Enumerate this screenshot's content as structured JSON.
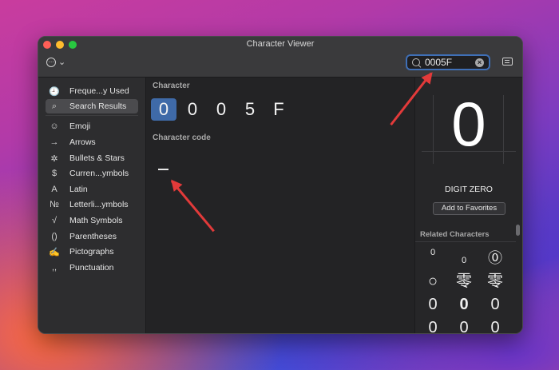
{
  "window": {
    "title": "Character Viewer",
    "traffic_lights": [
      "#ff5f57",
      "#febc2e",
      "#28c840"
    ]
  },
  "toolbar": {
    "more_icon": "ellipsis-circle-icon",
    "more_chevron": "⌄",
    "search_value": "0005F",
    "clear_symbol": "×"
  },
  "sidebar": {
    "items": [
      {
        "icon": "🕘",
        "label": "Freque...y Used",
        "selected": false
      },
      {
        "icon": "⌕",
        "label": "Search Results",
        "selected": true
      },
      {
        "icon": "☺",
        "label": "Emoji",
        "selected": false
      },
      {
        "icon": "→",
        "label": "Arrows",
        "selected": false
      },
      {
        "icon": "✲",
        "label": "Bullets & Stars",
        "selected": false
      },
      {
        "icon": "$",
        "label": "Curren...ymbols",
        "selected": false
      },
      {
        "icon": "A",
        "label": "Latin",
        "selected": false
      },
      {
        "icon": "№",
        "label": "Letterli...ymbols",
        "selected": false
      },
      {
        "icon": "√",
        "label": "Math Symbols",
        "selected": false
      },
      {
        "icon": "()",
        "label": "Parentheses",
        "selected": false
      },
      {
        "icon": "✍",
        "label": "Pictographs",
        "selected": false
      },
      {
        "icon": ",,",
        "label": "Punctuation",
        "selected": false
      }
    ]
  },
  "main": {
    "character_label": "Character",
    "characters": [
      "0",
      "0",
      "0",
      "5",
      "F"
    ],
    "selected_index": 0,
    "character_code_label": "Character code",
    "code_glyph": "_"
  },
  "detail": {
    "glyph": "0",
    "name": "DIGIT ZERO",
    "favorites_button": "Add to Favorites",
    "related_label": "Related Characters",
    "related": [
      "0",
      "0",
      "⓪",
      "○",
      "零",
      "零",
      "0",
      "0",
      "0",
      "0",
      "0",
      "0"
    ]
  },
  "annotation_color": "#e23a3a",
  "accent_color": "#3f6aa8"
}
